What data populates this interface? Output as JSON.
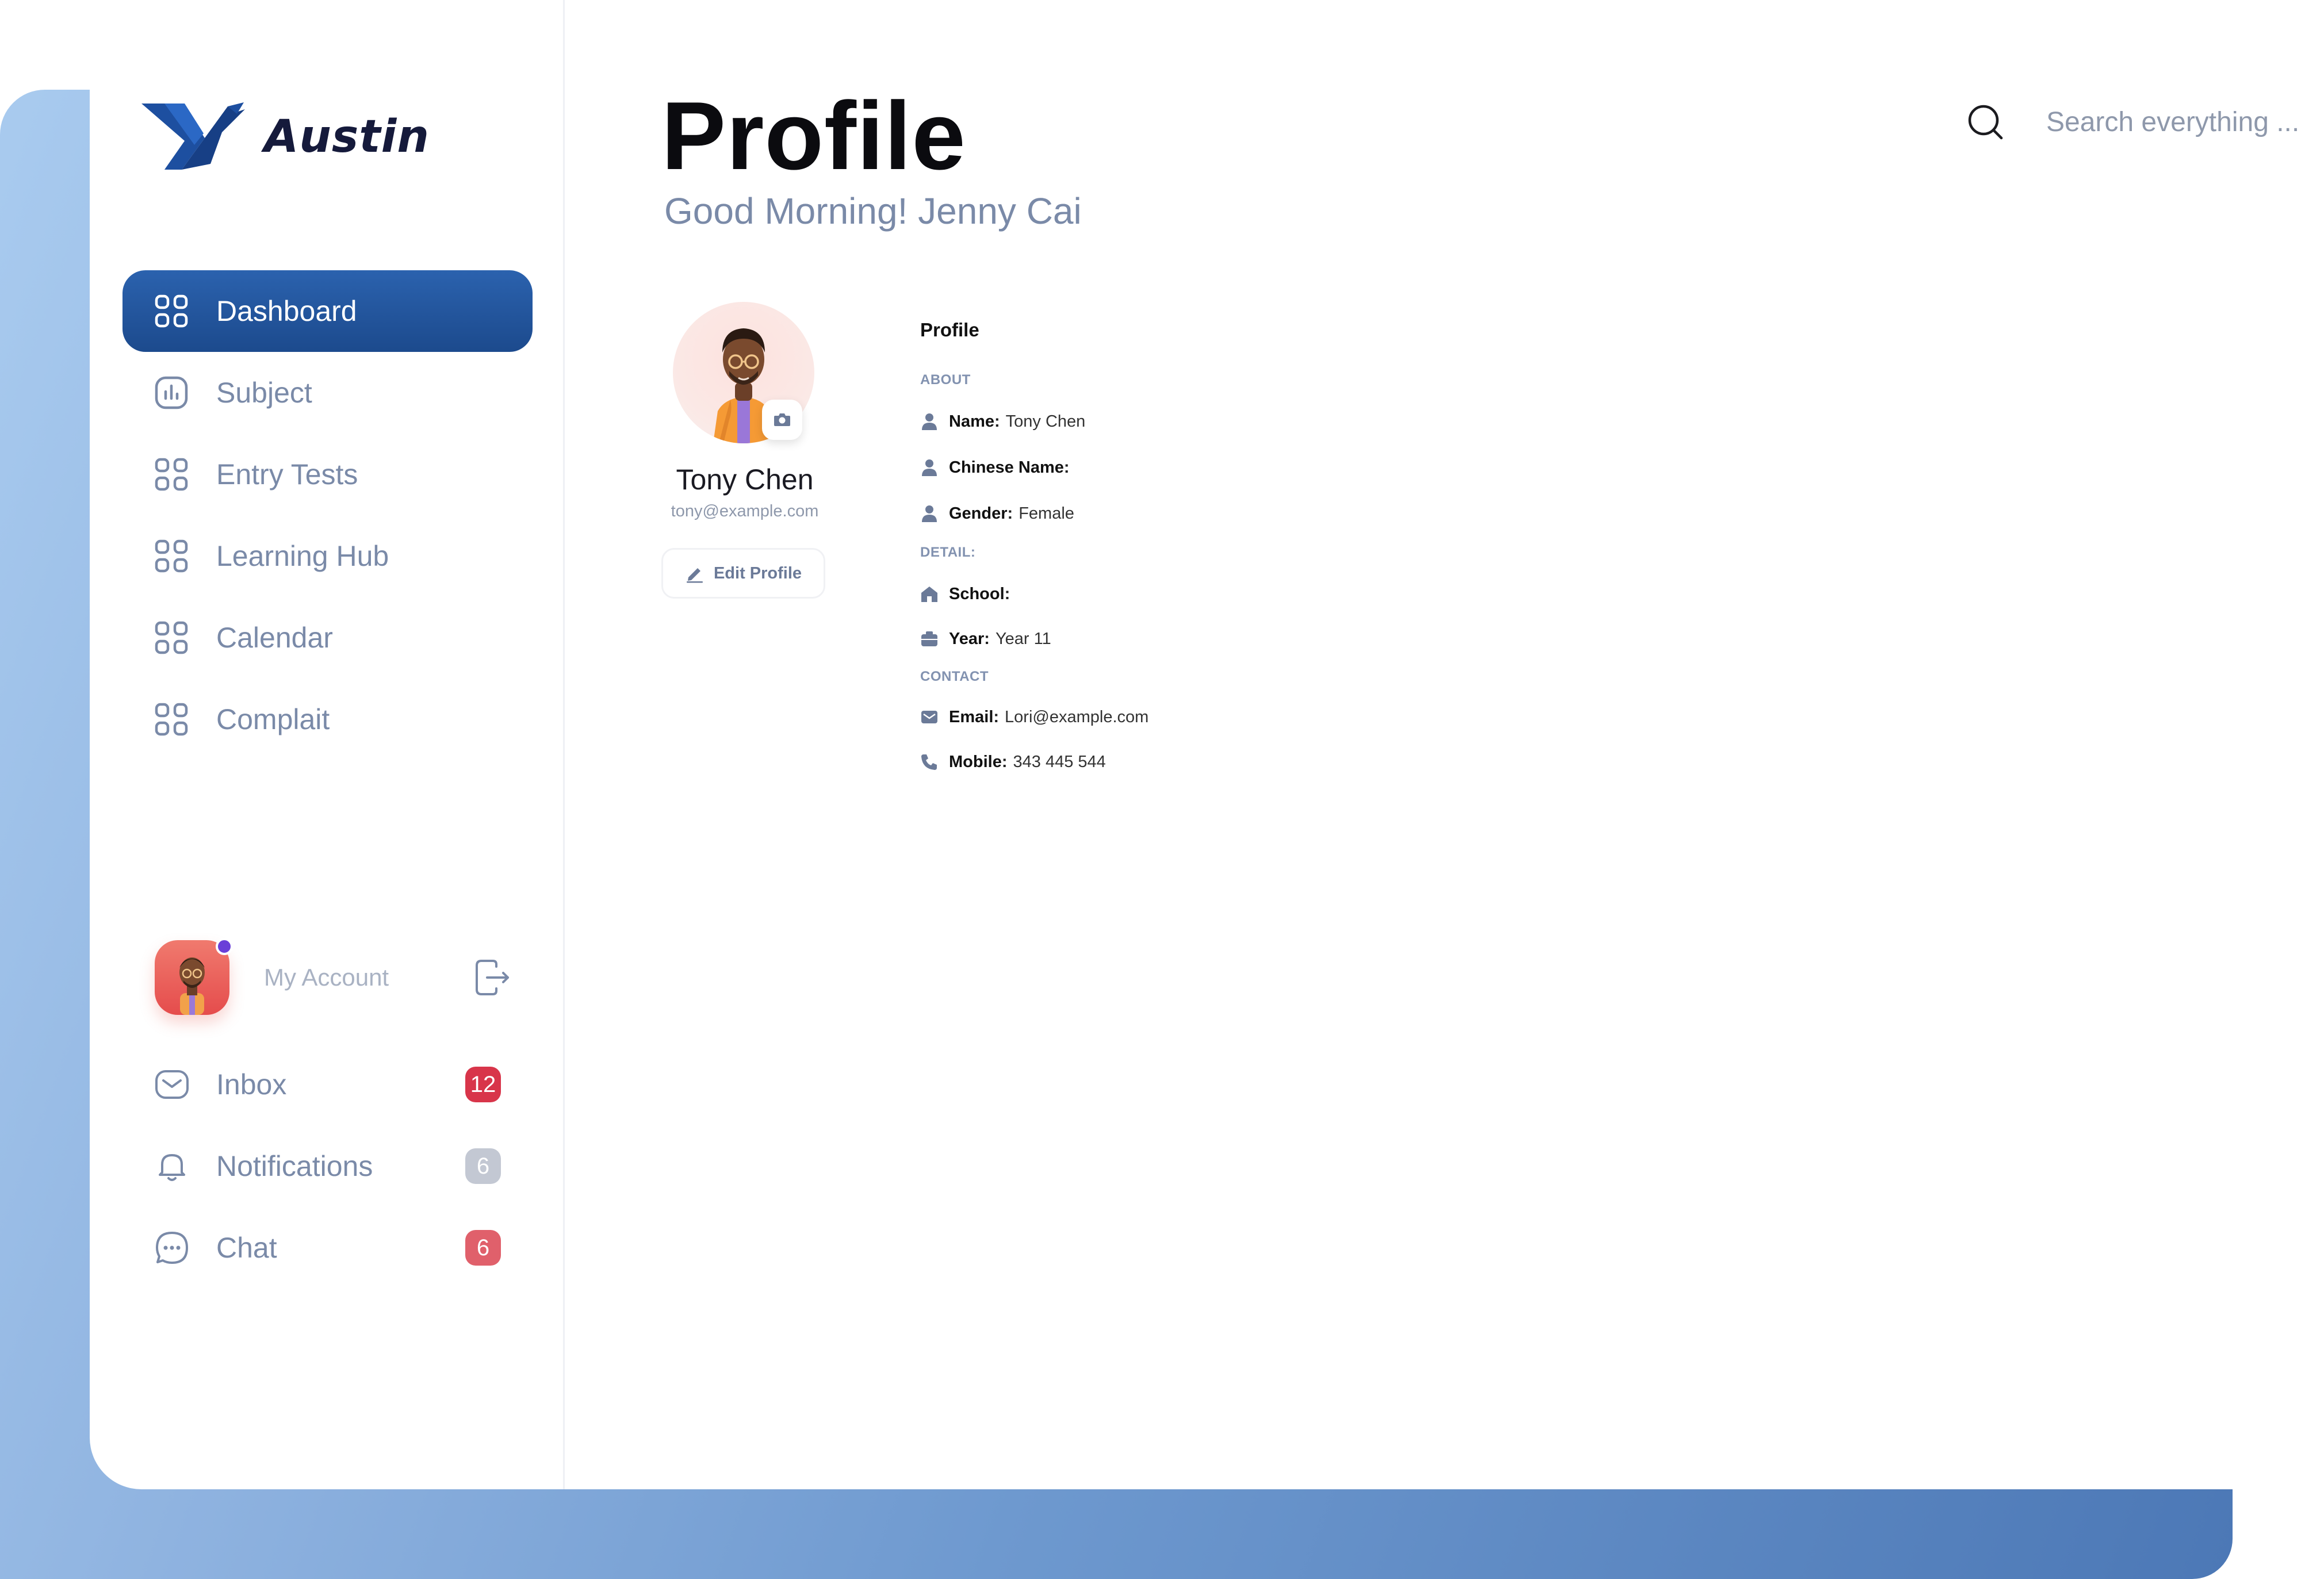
{
  "brand": {
    "name": "Austin"
  },
  "sidebar": {
    "items": [
      {
        "label": "Dashboard",
        "icon": "grid-icon",
        "active": true
      },
      {
        "label": "Subject",
        "icon": "chart-icon"
      },
      {
        "label": "Entry Tests",
        "icon": "grid-icon"
      },
      {
        "label": "Learning Hub",
        "icon": "grid-icon"
      },
      {
        "label": "Calendar",
        "icon": "grid-icon"
      },
      {
        "label": "Complait",
        "icon": "grid-icon"
      }
    ],
    "account": {
      "label": "My Account",
      "status_color": "#6a3fd8"
    },
    "bottom_items": [
      {
        "label": "Inbox",
        "icon": "mail-icon",
        "badge": "12",
        "badge_color": "#d8354a"
      },
      {
        "label": "Notifications",
        "icon": "bell-icon",
        "badge": "6",
        "badge_color": "#c3c8d3"
      },
      {
        "label": "Chat",
        "icon": "chat-icon",
        "badge": "6",
        "badge_color": "#e0606b"
      }
    ]
  },
  "header": {
    "title": "Profile",
    "greeting": "Good Morning! Jenny Cai",
    "search_placeholder": "Search everything ..."
  },
  "profile_card": {
    "name": "Tony Chen",
    "email": "tony@example.com",
    "edit_label": "Edit Profile"
  },
  "details": {
    "title": "Profile",
    "about_heading": "ABOUT",
    "detail_heading": "DETAIL:",
    "contact_heading": "CONTACT",
    "name_key": "Name",
    "name_value": "Tony Chen",
    "chinese_name_key": "Chinese Name",
    "chinese_name_value": "",
    "gender_key": "Gender",
    "gender_value": "Female",
    "school_key": "School",
    "school_value": "",
    "year_key": "Year",
    "year_value": "Year 11",
    "email_key": "Email",
    "email_value": "Lori@example.com",
    "mobile_key": "Mobile",
    "mobile_value": "343 445 544"
  },
  "colors": {
    "accent": "#1f4f95",
    "muted_text": "#7a8aa8",
    "frame_gradient_start": "#a9cbef",
    "frame_gradient_end": "#4c78b6"
  }
}
